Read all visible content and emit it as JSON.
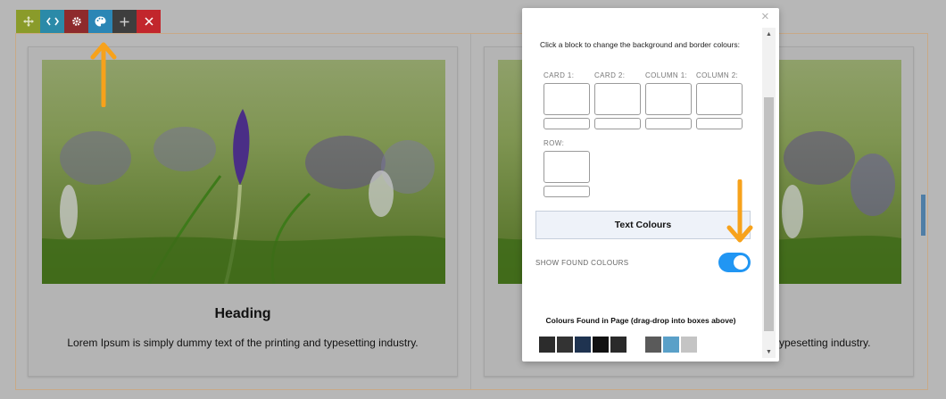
{
  "toolbar": {
    "buttons": [
      {
        "name": "move",
        "color": "#8a9b2a"
      },
      {
        "name": "code",
        "color": "#2b8aa8"
      },
      {
        "name": "settings",
        "color": "#8e2a2c"
      },
      {
        "name": "palette",
        "color": "#2b86b5"
      },
      {
        "name": "add",
        "color": "#3e3e3e"
      },
      {
        "name": "close",
        "color": "#c2262c"
      }
    ]
  },
  "cards": [
    {
      "heading": "Heading",
      "text": "Lorem Ipsum is simply dummy text of the printing and typesetting industry."
    },
    {
      "heading": "",
      "text": "ypesetting industry."
    }
  ],
  "modal": {
    "instructions": "Click a block to change the background and border colours:",
    "swatches": [
      {
        "label": "CARD 1:"
      },
      {
        "label": "CARD 2:"
      },
      {
        "label": "COLUMN 1:"
      },
      {
        "label": "COLUMN 2:"
      },
      {
        "label": "ROW:"
      }
    ],
    "text_colours_button": "Text Colours",
    "toggle_label": "SHOW FOUND COLOURS",
    "toggle_on": true,
    "found_title": "Colours Found in Page (drag-drop into boxes above)",
    "found_colours": [
      "#2c2c2c",
      "#333333",
      "#1f3350",
      "#111111",
      "#2a2a2a",
      "#5a5a5a",
      "#5aa0c8",
      "#c4c4c4"
    ]
  },
  "annotations": {
    "arrow_color": "#f7a21b"
  }
}
